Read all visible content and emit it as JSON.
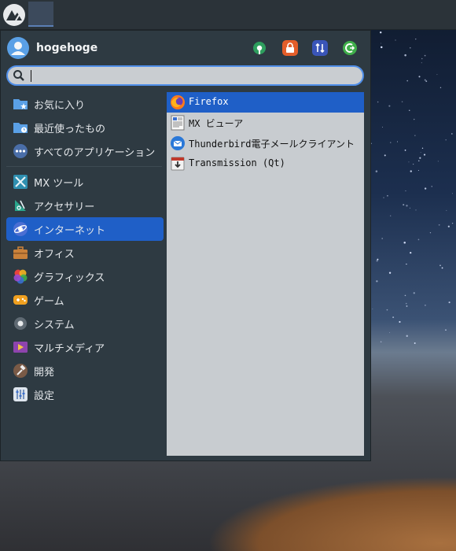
{
  "user": {
    "name": "hogehoge"
  },
  "actions": [
    {
      "name": "settings",
      "icon": "settings-gear-icon",
      "color": "#2e9e5e"
    },
    {
      "name": "lock",
      "icon": "lock-icon",
      "color": "#e45e2a"
    },
    {
      "name": "switch-user",
      "icon": "switch-user-icon",
      "color": "#3a6fd0"
    },
    {
      "name": "logout",
      "icon": "logout-icon",
      "color": "#3fae4a"
    }
  ],
  "search": {
    "value": "",
    "placeholder": ""
  },
  "categories": [
    {
      "label": "お気に入り",
      "icon": "favorites-folder-icon"
    },
    {
      "label": "最近使ったもの",
      "icon": "recent-folder-icon"
    },
    {
      "label": "すべてのアプリケーション",
      "icon": "all-apps-icon"
    },
    {
      "label": "MX ツール",
      "icon": "mx-tools-icon"
    },
    {
      "label": "アクセサリー",
      "icon": "accessories-icon"
    },
    {
      "label": "インターネット",
      "icon": "internet-globe-icon",
      "active": true
    },
    {
      "label": "オフィス",
      "icon": "office-briefcase-icon"
    },
    {
      "label": "グラフィックス",
      "icon": "graphics-icon"
    },
    {
      "label": "ゲーム",
      "icon": "games-controller-icon"
    },
    {
      "label": "システム",
      "icon": "system-gear-icon"
    },
    {
      "label": "マルチメディア",
      "icon": "multimedia-icon"
    },
    {
      "label": "開発",
      "icon": "development-hammer-icon"
    },
    {
      "label": "設定",
      "icon": "settings-sliders-icon"
    }
  ],
  "apps": [
    {
      "label": "Firefox",
      "icon": "firefox-icon",
      "selected": true
    },
    {
      "label": "MX ビューア",
      "icon": "mx-viewer-icon"
    },
    {
      "label": "Thunderbird電子メールクライアント",
      "icon": "thunderbird-icon"
    },
    {
      "label": "Transmission (Qt)",
      "icon": "transmission-icon"
    }
  ],
  "colors": {
    "accent": "#1f5fc7",
    "menu_bg": "#2e3a42",
    "app_list_bg": "#c8ccd0"
  }
}
